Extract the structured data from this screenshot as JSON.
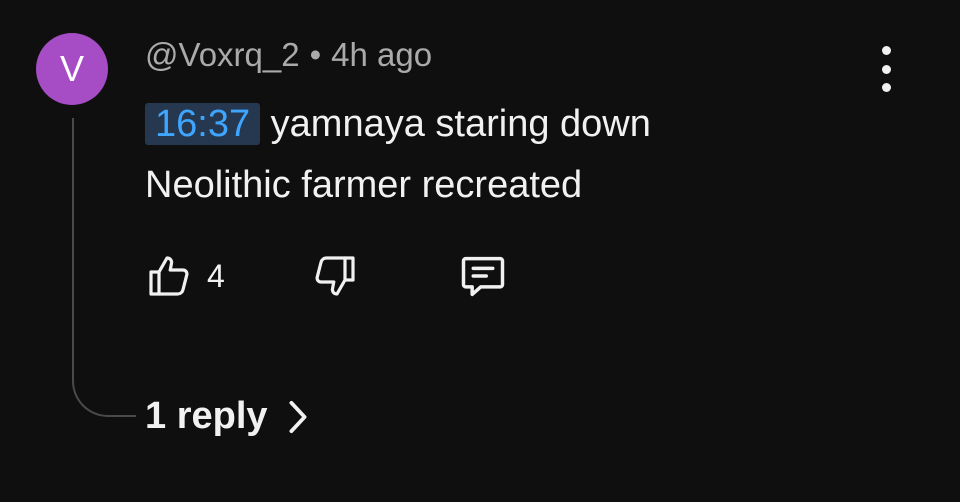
{
  "avatar": {
    "initial": "V",
    "color": "#a64cc5"
  },
  "comment": {
    "author": "@Voxrq_2",
    "separator": "•",
    "time_ago": "4h ago",
    "timestamp_link": "16:37",
    "text_line1": "yamnaya staring down",
    "text_line2": "Neolithic farmer recreated"
  },
  "actions": {
    "like_icon": "thumbs-up-icon",
    "like_count": "4",
    "dislike_icon": "thumbs-down-icon",
    "reply_icon": "comment-icon"
  },
  "menu": {
    "icon": "more-vertical-icon"
  },
  "replies": {
    "label": "1 reply",
    "icon": "chevron-right-icon"
  },
  "colors": {
    "background": "#0f0f0f",
    "link": "#3ea6ff",
    "muted": "#aaaaaa"
  }
}
